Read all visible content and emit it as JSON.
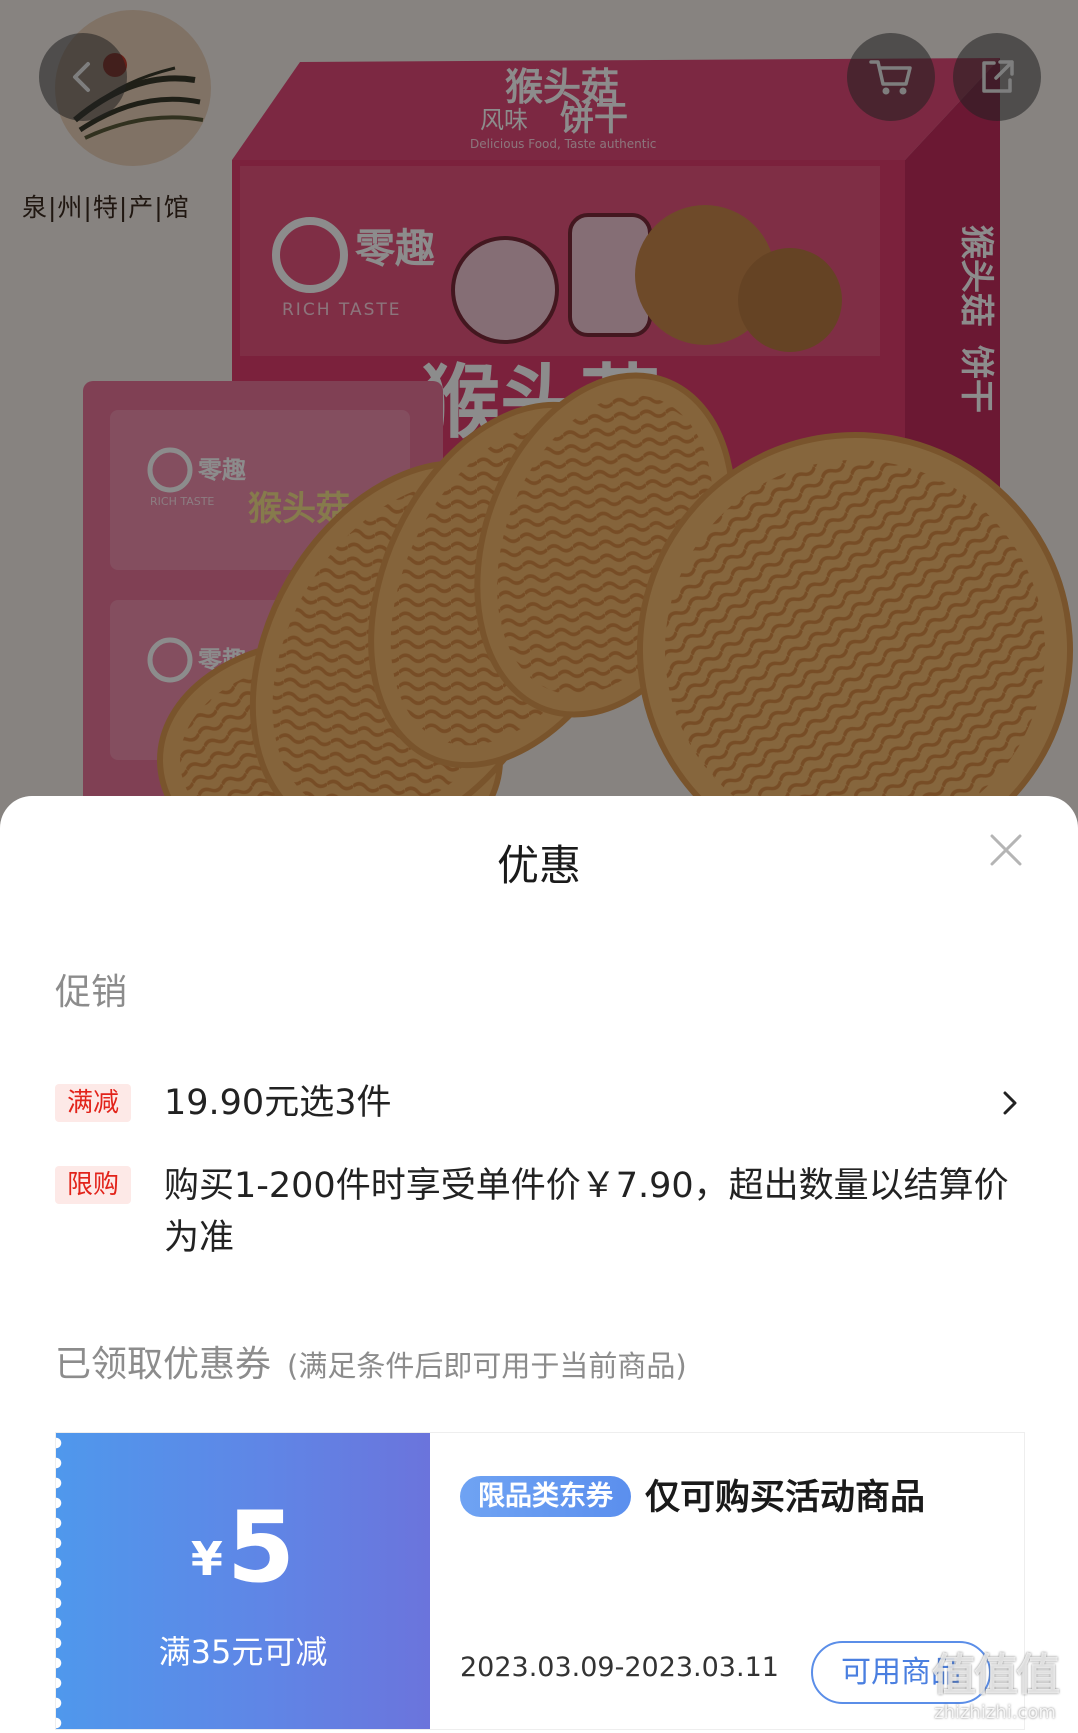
{
  "header": {
    "back_icon": "chevron-left-icon",
    "cart_icon": "cart-icon",
    "share_icon": "share-icon"
  },
  "shop_logo": {
    "text": "泉|州|特|产|馆"
  },
  "product_image": {
    "name_main": "猴头菇",
    "name_flavor": "风味",
    "name_tail": "饼干",
    "tagline": "Delicious Food, Taste authentic",
    "brand": "零趣",
    "brand_en": "RICH TASTE"
  },
  "sheet": {
    "title": "优惠",
    "close_icon": "close-icon"
  },
  "promotion": {
    "heading": "促销",
    "items": [
      {
        "tag": "满减",
        "text": "19.90元选3件",
        "arrow_icon": "chevron-right-icon"
      },
      {
        "tag": "限购",
        "text": "购买1-200件时享受单件价￥7.90，超出数量以结算价为准"
      }
    ]
  },
  "coupons": {
    "heading": "已领取优惠券",
    "note": "(满足条件后即可用于当前商品)",
    "items": [
      {
        "currency": "¥",
        "amount": "5",
        "condition": "满35元可减",
        "tag": "限品类东券",
        "title": "仅可购买活动商品",
        "validity": "2023.03.09-2023.03.11",
        "action": "可用商品"
      }
    ]
  },
  "colors": {
    "accent_red": "#e2231a",
    "tag_bg": "#fde9e7",
    "coupon_blue": "#4f98ec",
    "coupon_purple": "#6b74dc",
    "action_blue": "#4a7fe0"
  },
  "watermark": {
    "mark": "值值值",
    "domain": "zhizhizhi.com"
  }
}
